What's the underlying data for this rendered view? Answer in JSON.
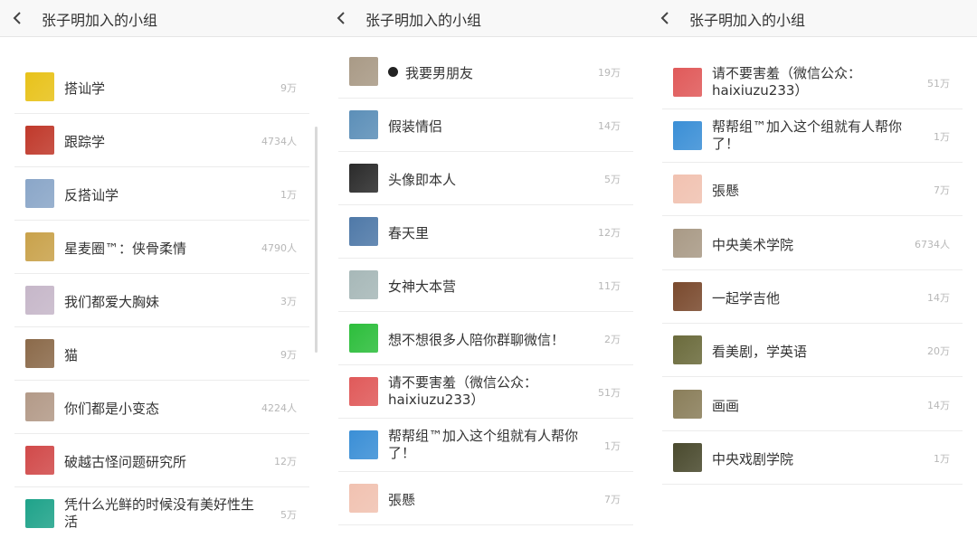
{
  "header": {
    "title": "张子明加入的小组"
  },
  "panels": [
    {
      "items": [
        {
          "name": "",
          "count": "",
          "color": "#d9a84a"
        },
        {
          "name": "搭讪学",
          "count": "9万",
          "color": "#e8c21a"
        },
        {
          "name": "跟踪学",
          "count": "4734人",
          "color": "#c0392b"
        },
        {
          "name": "反搭讪学",
          "count": "1万",
          "color": "#8aa6c8"
        },
        {
          "name": "星麦圈™：侠骨柔情",
          "count": "4790人",
          "color": "#c9a24b"
        },
        {
          "name": "我们都爱大胸妹",
          "count": "3万",
          "color": "#c6b7c9"
        },
        {
          "name": "猫",
          "count": "9万",
          "color": "#8b6a4a"
        },
        {
          "name": "你们都是小变态",
          "count": "4224人",
          "color": "#b39a88"
        },
        {
          "name": "破越古怪问题研究所",
          "count": "12万",
          "color": "#d14a4a"
        },
        {
          "name": "凭什么光鲜的时候没有美好性生活",
          "count": "5万",
          "color": "#1fa38a"
        }
      ]
    },
    {
      "items": [
        {
          "name": "我要男朋友",
          "count": "19万",
          "color": "#a99a86",
          "dot": true
        },
        {
          "name": "假装情侣",
          "count": "14万",
          "color": "#5c8fb8"
        },
        {
          "name": "头像即本人",
          "count": "5万",
          "color": "#2b2b2b"
        },
        {
          "name": "春天里",
          "count": "12万",
          "color": "#4f79a8"
        },
        {
          "name": "女神大本营",
          "count": "11万",
          "color": "#a7b8b8"
        },
        {
          "name": "想不想很多人陪你群聊微信！",
          "count": "2万",
          "color": "#2dbe3c"
        },
        {
          "name": "请不要害羞（微信公众：haixiuzu233）",
          "count": "51万",
          "color": "#e05a5a"
        },
        {
          "name": "帮帮组™加入这个组就有人帮你了！",
          "count": "1万",
          "color": "#3b8fd6"
        },
        {
          "name": "張懸",
          "count": "7万",
          "color": "#f1c2b1"
        }
      ]
    },
    {
      "items": [
        {
          "name": "",
          "count": "",
          "color": "#3cb44a"
        },
        {
          "name": "请不要害羞（微信公众：haixiuzu233）",
          "count": "51万",
          "color": "#e05a5a"
        },
        {
          "name": "帮帮组™加入这个组就有人帮你了！",
          "count": "1万",
          "color": "#3b8fd6"
        },
        {
          "name": "張懸",
          "count": "7万",
          "color": "#f1c2b1"
        },
        {
          "name": "中央美术学院",
          "count": "6734人",
          "color": "#a99a86"
        },
        {
          "name": "一起学吉他",
          "count": "14万",
          "color": "#7a4a2e"
        },
        {
          "name": "看美剧，学英语",
          "count": "20万",
          "color": "#6b6b3c"
        },
        {
          "name": "画画",
          "count": "14万",
          "color": "#8a7e5a"
        },
        {
          "name": "中央戏剧学院",
          "count": "1万",
          "color": "#4a4a2e"
        }
      ]
    }
  ]
}
